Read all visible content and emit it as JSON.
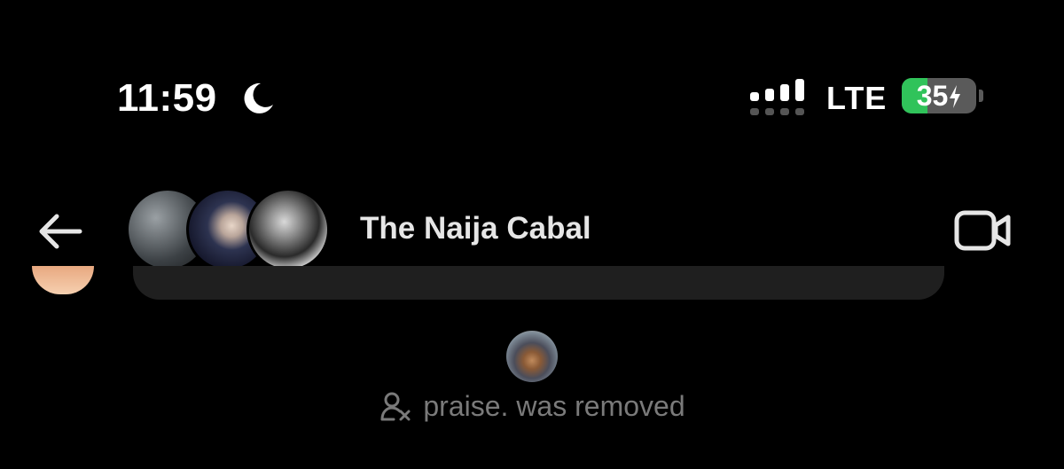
{
  "status_bar": {
    "time": "11:59",
    "focus_icon": "moon-icon",
    "signal_icon": "cellular-signal-icon",
    "network": "LTE",
    "battery_level": "35",
    "battery_charging": true,
    "battery_color": "#30c35a"
  },
  "header": {
    "back_icon": "back-arrow-icon",
    "group_name": "The Naija Cabal",
    "video_icon": "video-camera-icon"
  },
  "event": {
    "icon": "remove-user-icon",
    "text": "praise. was removed"
  },
  "colors": {
    "background": "#000000",
    "muted_text": "#7a7a7a",
    "bubble": "#1f1f1f"
  }
}
